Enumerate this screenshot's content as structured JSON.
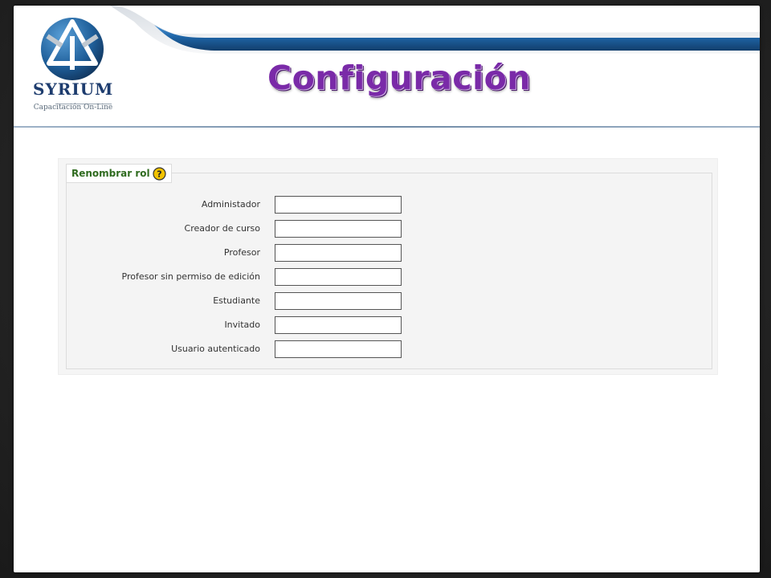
{
  "header": {
    "title": "Configuración",
    "logo_name": "SYRIUM",
    "logo_tagline": "Capacitación On-Line"
  },
  "form": {
    "legend": "Renombrar rol",
    "help_icon": "question-icon",
    "fields": [
      {
        "label": "Administador",
        "value": ""
      },
      {
        "label": "Creador de curso",
        "value": ""
      },
      {
        "label": "Profesor",
        "value": ""
      },
      {
        "label": "Profesor sin permiso de edición",
        "value": ""
      },
      {
        "label": "Estudiante",
        "value": ""
      },
      {
        "label": "Invitado",
        "value": ""
      },
      {
        "label": "Usuario autenticado",
        "value": ""
      }
    ]
  },
  "colors": {
    "title": "#7a2aa8",
    "legend_text": "#2f6b1f",
    "header_band": "#1f5f9a",
    "help_icon": "#f2c200"
  }
}
